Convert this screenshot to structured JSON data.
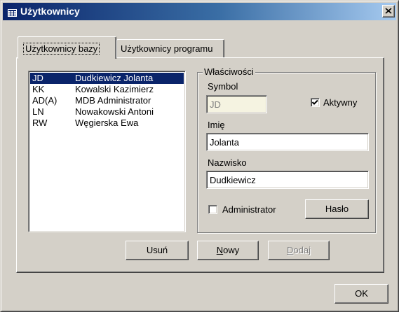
{
  "window": {
    "title": "Użytkownicy",
    "close_glyph": "close-icon"
  },
  "tabs": [
    {
      "label": "Użytkownicy bazy",
      "active": true
    },
    {
      "label": "Użytkownicy programu",
      "active": false
    }
  ],
  "users": [
    {
      "code": "JD",
      "name": "Dudkiewicz Jolanta",
      "selected": true
    },
    {
      "code": "KK",
      "name": "Kowalski Kazimierz",
      "selected": false
    },
    {
      "code": "AD(A)",
      "name": "MDB Administrator",
      "selected": false
    },
    {
      "code": "LN",
      "name": "Nowakowski Antoni",
      "selected": false
    },
    {
      "code": "RW",
      "name": "Węgierska Ewa",
      "selected": false
    }
  ],
  "properties": {
    "legend": "Właściwości",
    "symbol_label": "Symbol",
    "symbol_value": "JD",
    "active_label": "Aktywny",
    "active_checked": true,
    "first_name_label": "Imię",
    "first_name_value": "Jolanta",
    "last_name_label": "Nazwisko",
    "last_name_value": "Dudkiewicz",
    "admin_label": "Administrator",
    "admin_checked": false,
    "password_button": "Hasło"
  },
  "actions": {
    "delete": "Usuń",
    "new_first": "N",
    "new_rest": "owy",
    "add_first": "D",
    "add_rest": "odaj",
    "ok": "OK"
  },
  "colors": {
    "title_gradient_start": "#0a246a",
    "title_gradient_end": "#a6caf0",
    "selection": "#0a246a",
    "face": "#d4d0c8"
  }
}
